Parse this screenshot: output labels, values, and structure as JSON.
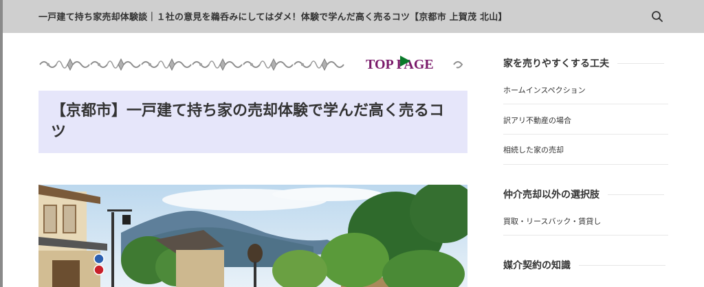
{
  "header": {
    "site_title": "一戸建て持ち家売却体験談｜１社の意見を鵜呑みにしてはダメ！体験で学んだ高く売るコツ【京都市 上賀茂 北山】",
    "search_icon": "search-icon"
  },
  "main": {
    "top_page_label": "TOP PAGE",
    "page_title": "【京都市】一戸建て持ち家の売却体験で学んだ高く売るコツ",
    "title_bg": "#e6e6fa",
    "hero_alt": "京都の町並み"
  },
  "sidebar": {
    "widgets": [
      {
        "title": "家を売りやすくする工夫",
        "links": [
          "ホームインスペクション",
          "訳アリ不動産の場合",
          "相続した家の売却"
        ]
      },
      {
        "title": "仲介売却以外の選択肢",
        "links": [
          "買取・リースバック・賃貸し"
        ]
      },
      {
        "title": "媒介契約の知識",
        "links": []
      }
    ]
  },
  "colors": {
    "header_bg": "#cfcfcf",
    "top_page_text": "#7a1a6a",
    "play_icon": "#0a7a2a"
  }
}
